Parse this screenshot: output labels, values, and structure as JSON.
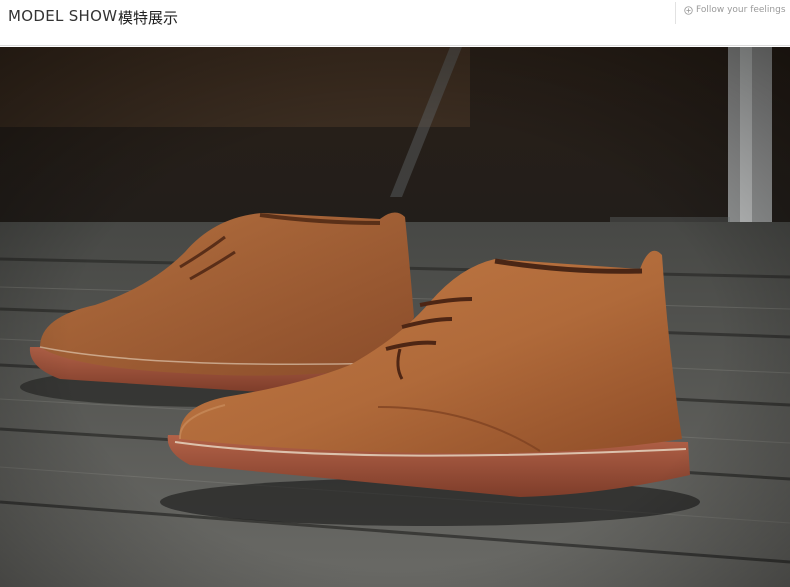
{
  "header": {
    "title_en": "MODEL SHOW",
    "title_cn": "模特展示",
    "follow_label": "Follow your feelings",
    "follow_icon": "circle-plus-icon"
  },
  "photo": {
    "subject": "brown suede chukka boots on wooden deck",
    "colors": {
      "suede": "#b0683a",
      "sole": "#a05238",
      "deck": "#5c5d58"
    }
  }
}
